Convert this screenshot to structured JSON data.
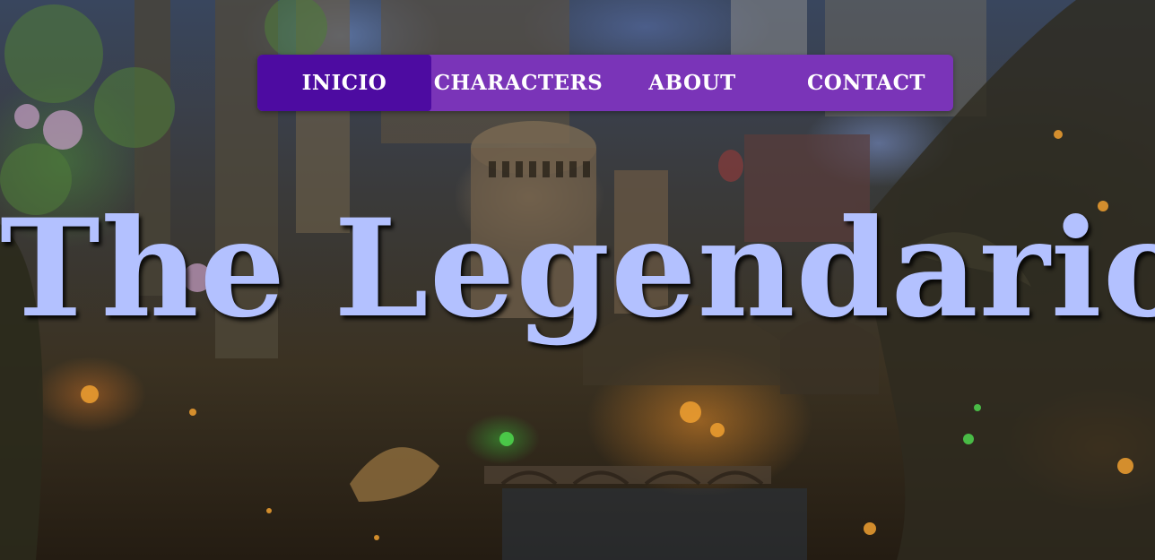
{
  "nav": {
    "items": [
      {
        "label": "INICIO",
        "active": true
      },
      {
        "label": "CHARACTERS",
        "active": false
      },
      {
        "label": "ABOUT",
        "active": false
      },
      {
        "label": "CONTACT",
        "active": false
      }
    ]
  },
  "hero": {
    "title": "The Legendario"
  },
  "colors": {
    "navbar_bg": "#7a34b8",
    "navbar_active_bg": "#4d0ba1",
    "nav_text": "#ffffff",
    "title_text": "#b3c1ff"
  }
}
